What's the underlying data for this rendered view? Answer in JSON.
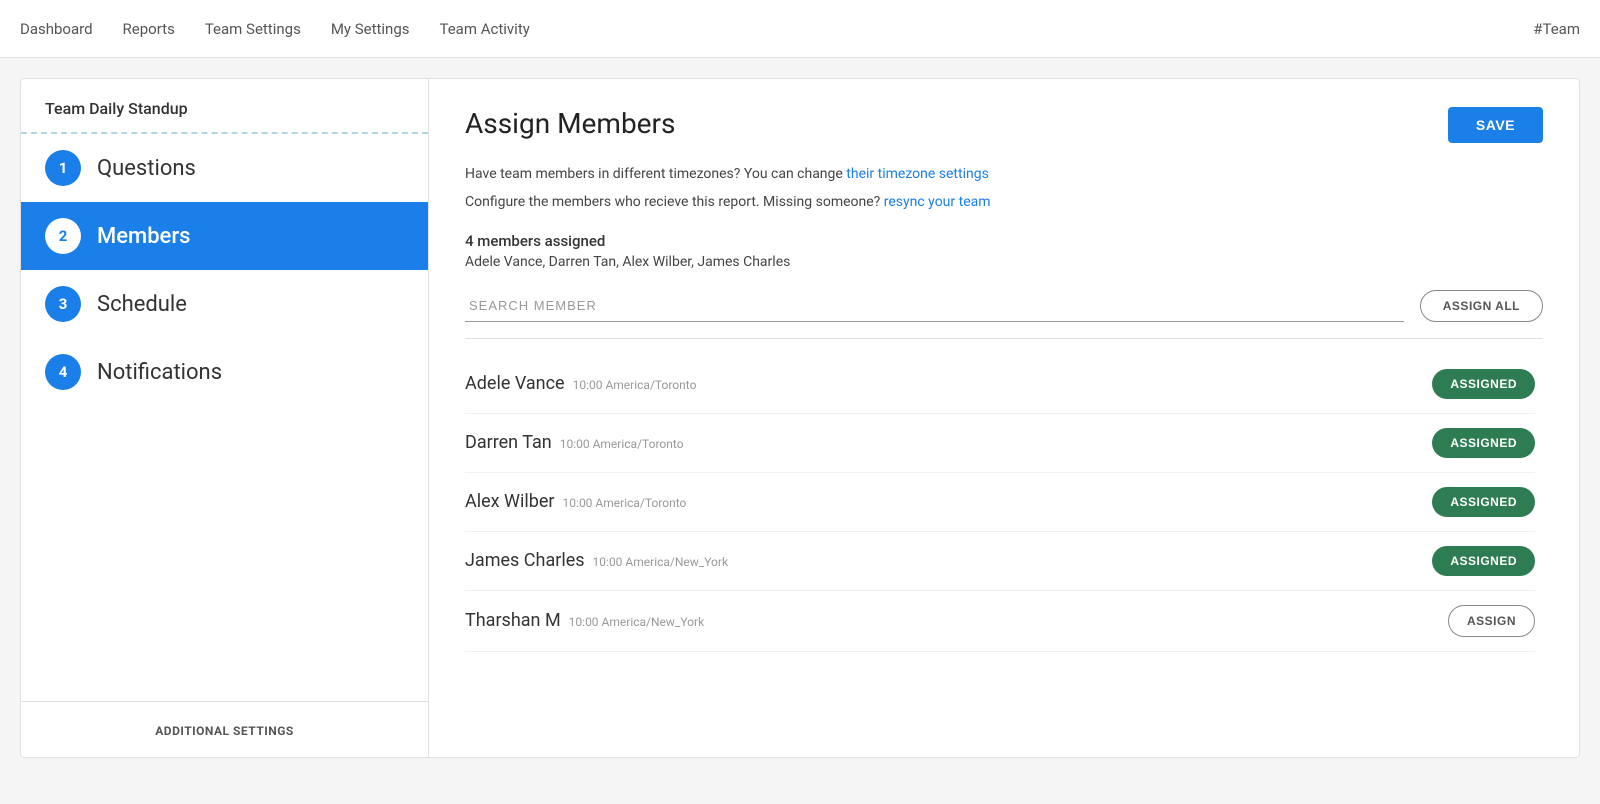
{
  "nav": {
    "items": [
      {
        "label": "Dashboard",
        "id": "dashboard"
      },
      {
        "label": "Reports",
        "id": "reports"
      },
      {
        "label": "Team Settings",
        "id": "team-settings"
      },
      {
        "label": "My Settings",
        "id": "my-settings"
      },
      {
        "label": "Team Activity",
        "id": "team-activity"
      }
    ],
    "brand": "#Team"
  },
  "sidebar": {
    "title": "Team Daily Standup",
    "steps": [
      {
        "number": "1",
        "label": "Questions",
        "active": false
      },
      {
        "number": "2",
        "label": "Members",
        "active": true
      },
      {
        "number": "3",
        "label": "Schedule",
        "active": false
      },
      {
        "number": "4",
        "label": "Notifications",
        "active": false
      }
    ],
    "additional_settings": "ADDITIONAL SETTINGS"
  },
  "content": {
    "title": "Assign Members",
    "save_button": "SAVE",
    "info_line1_prefix": "Have team members in different timezones? You can change ",
    "info_line1_link": "their timezone settings",
    "info_line2_prefix": "Configure the members who recieve this report. Missing someone? ",
    "info_line2_link": "resync your team",
    "members_count": "4 members assigned",
    "members_list": "Adele Vance, Darren Tan, Alex Wilber, James Charles",
    "search_placeholder": "SEARCH MEMBER",
    "assign_all_label": "ASSIGN ALL",
    "members": [
      {
        "name": "Adele Vance",
        "timezone": "10:00 America/Toronto",
        "status": "assigned"
      },
      {
        "name": "Darren Tan",
        "timezone": "10:00 America/Toronto",
        "status": "assigned"
      },
      {
        "name": "Alex Wilber",
        "timezone": "10:00 America/Toronto",
        "status": "assigned"
      },
      {
        "name": "James Charles",
        "timezone": "10:00 America/New_York",
        "status": "assigned"
      },
      {
        "name": "Tharshan M",
        "timezone": "10:00 America/New_York",
        "status": "unassigned"
      }
    ],
    "assigned_label": "ASSIGNED",
    "assign_label": "ASSIGN"
  }
}
